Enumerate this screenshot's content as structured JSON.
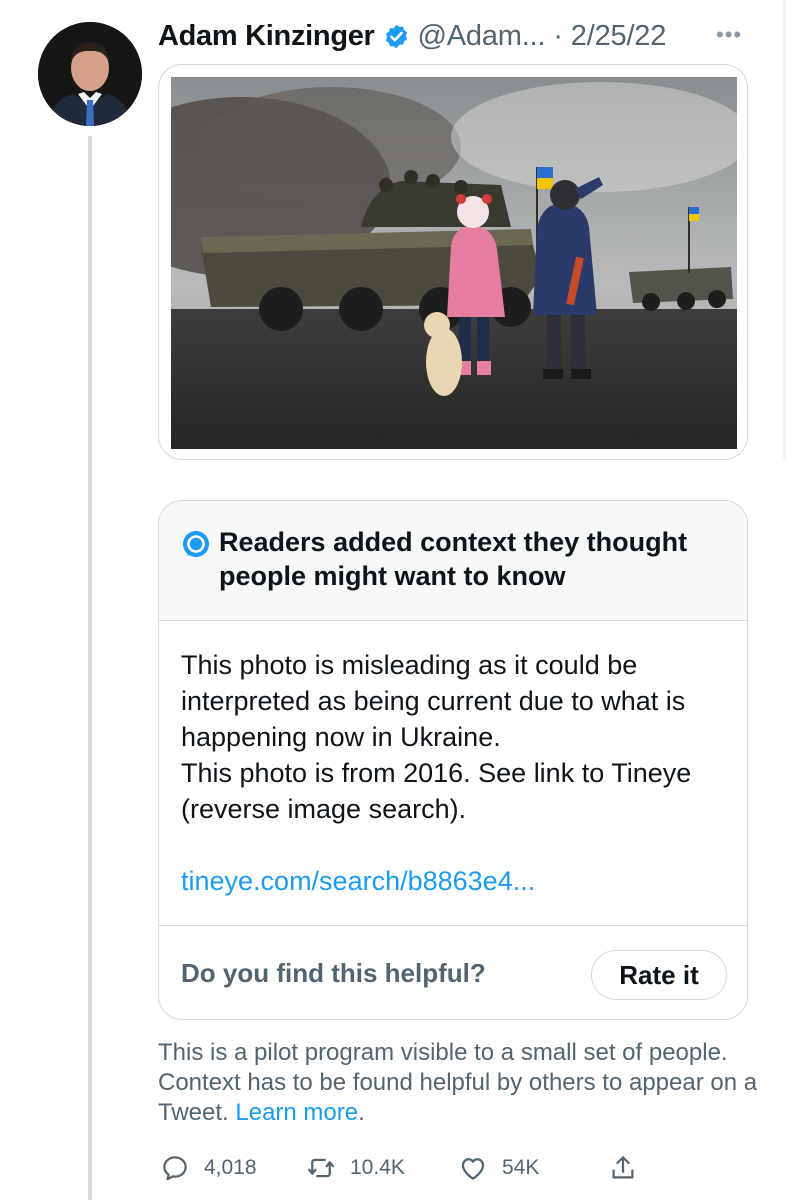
{
  "tweet": {
    "author_name": "Adam Kinzinger",
    "handle": "@Adam...",
    "separator": "·",
    "date": "2/25/22",
    "more_glyph": "•••"
  },
  "note": {
    "title": "Readers added context they thought people might want to know",
    "body_lines": [
      "This photo is misleading as it could be interpreted as being current due to what is happening now in Ukraine.",
      "This photo is from 2016. See link to Tineye (reverse image search)."
    ],
    "link_text": "tineye.com/search/b8863e4...",
    "helpful_question": "Do you find this helpful?",
    "rate_label": "Rate it"
  },
  "pilot": {
    "text": "This is a pilot program visible to a small set of people. Context has to be found helpful by others to appear on a Tweet.",
    "learn_more": "Learn more",
    "period": "."
  },
  "actions": {
    "replies": "4,018",
    "retweets": "10.4K",
    "likes": "54K"
  },
  "colors": {
    "accent": "#1d9bf0",
    "text_secondary": "#536471",
    "border": "#cfd9de"
  },
  "icons": [
    "verified-badge-icon",
    "more-icon",
    "note-icon",
    "reply-icon",
    "retweet-icon",
    "like-icon",
    "share-icon"
  ]
}
